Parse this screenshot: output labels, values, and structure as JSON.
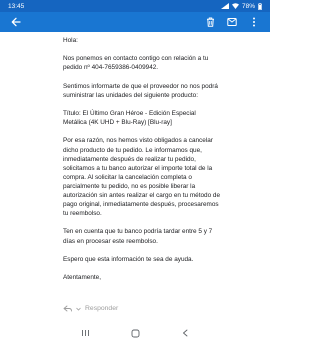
{
  "status_bar": {
    "time": "13:45",
    "battery": "78%"
  },
  "app_bar": {
    "back_icon": "arrow-left-icon",
    "delete_icon": "trash-icon",
    "mark_icon": "mark-unread-icon",
    "more_icon": "more-vertical-icon"
  },
  "email": {
    "greeting": "Hola:",
    "p1": "Nos ponemos en contacto contigo con relación a tu pedido nº 404-7659386-0409942.",
    "p2": "Sentimos informarte de que el proveedor no nos podrá suministrar las unidades del siguiente producto:",
    "p3": "Título: El Último Gran Héroe - Edición Especial Metálica (4K UHD + Blu-Ray) [Blu-ray]",
    "p4": "Por esa razón, nos hemos visto obligados a cancelar dicho producto de tu pedido. Le informamos que, inmediatamente después de realizar tu pedido, solicitamos a tu banco autorizar el importe total de la compra. Al solicitar la cancelación completa o parcialmente tu pedido, no es posible liberar la autorización sin antes realizar el cargo en tu método de pago original, inmediatamente después, procesaremos tu reembolso.",
    "p5": "Ten en cuenta que tu banco podría tardar entre 5 y 7 días en procesar este reembolso.",
    "p6": "Espero que esta información te sea de ayuda.",
    "closing": "Atentamente,"
  },
  "reply": {
    "label": "Responder"
  },
  "nav": {
    "recents_icon": "recent-apps-icon",
    "home_icon": "home-icon",
    "back_icon": "nav-back-icon"
  }
}
